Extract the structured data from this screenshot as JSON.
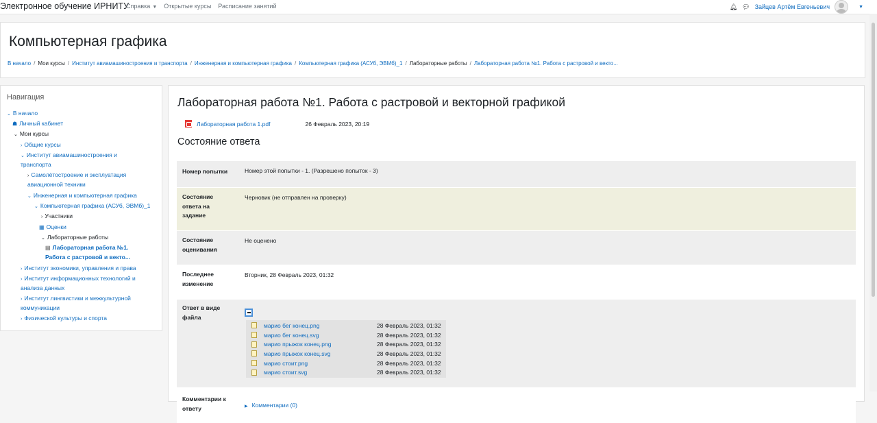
{
  "navbar": {
    "brand": "Электронное обучение ИРНИТУ",
    "menu": [
      "Справка",
      "Открытые курсы",
      "Расписание занятий"
    ],
    "user_name": "Зайцев Артём Евгеньевич"
  },
  "header": {
    "title": "Компьютерная графика",
    "breadcrumb": [
      "В начало",
      "Мои курсы",
      "Институт авиамашиностроения и транспорта",
      "Инженерная и компьютерная графика",
      "Компьютерная графика (АСУб, ЭВМб)_1",
      "Лабораторные работы",
      "Лабораторная работа №1. Работа с растровой и векто..."
    ]
  },
  "navigation": {
    "title": "Навигация",
    "items": {
      "home": "В начало",
      "dashboard": "Личный кабинет",
      "my_courses": "Мои курсы",
      "general": "Общие курсы",
      "aviation_l1": "Институт авиамашиностроения и",
      "aviation_l2": "транспорта",
      "selfdrive_l1": "Самолётостроение и эксплуатация",
      "selfdrive_l2": "авиационной техники",
      "eng_graphics": "Инженерная и компьютерная графика",
      "course": "Компьютерная графика (АСУб, ЭВМб)_1",
      "participants": "Участники",
      "grades": "Оценки",
      "labs": "Лабораторные работы",
      "lab1_l1": "Лабораторная работа №1.",
      "lab1_l2": "Работа с растровой и векто...",
      "economics": "Институт экономики, управления и права",
      "it_l1": "Институт информационных технологий и",
      "it_l2": "анализа данных",
      "ling_l1": "Институт лингвистики и межкультурной",
      "ling_l2": "коммуникации",
      "sport": "Физической культуры и спорта"
    }
  },
  "assignment": {
    "title": "Лабораторная работа №1. Работа с растровой и векторной графикой",
    "attachment_name": "Лабораторная работа 1.pdf",
    "attachment_date": "26 Февраль 2023, 20:19",
    "section_title": "Состояние ответа"
  },
  "status_table": {
    "attempt_label": "Номер попытки",
    "attempt_value": "Номер этой попытки - 1. (Разрешено попыток - 3)",
    "submission_label_l1": "Состояние",
    "submission_label_l2": "ответа на",
    "submission_label_l3": "задание",
    "submission_value": "Черновик (не отправлен на проверку)",
    "grading_label_l1": "Состояние",
    "grading_label_l2": "оценивания",
    "grading_value": "Не оценено",
    "modified_label_l1": "Последнее",
    "modified_label_l2": "изменение",
    "modified_value": "Вторник, 28 Февраль 2023, 01:32",
    "files_label_l1": "Ответ в виде",
    "files_label_l2": "файла",
    "files": [
      {
        "name": "марио бег конец.png",
        "date": "28 Февраль 2023, 01:32"
      },
      {
        "name": "марио бег конец.svg",
        "date": "28 Февраль 2023, 01:32"
      },
      {
        "name": "марио прыжок конец.png",
        "date": "28 Февраль 2023, 01:32"
      },
      {
        "name": "марио прыжок конец.svg",
        "date": "28 Февраль 2023, 01:32"
      },
      {
        "name": "марио стоит.png",
        "date": "28 Февраль 2023, 01:32"
      },
      {
        "name": "марио стоит.svg",
        "date": "28 Февраль 2023, 01:32"
      }
    ],
    "comments_label_l1": "Комментарии к",
    "comments_label_l2": "ответу",
    "comments_link": "Комментарии (0)"
  }
}
